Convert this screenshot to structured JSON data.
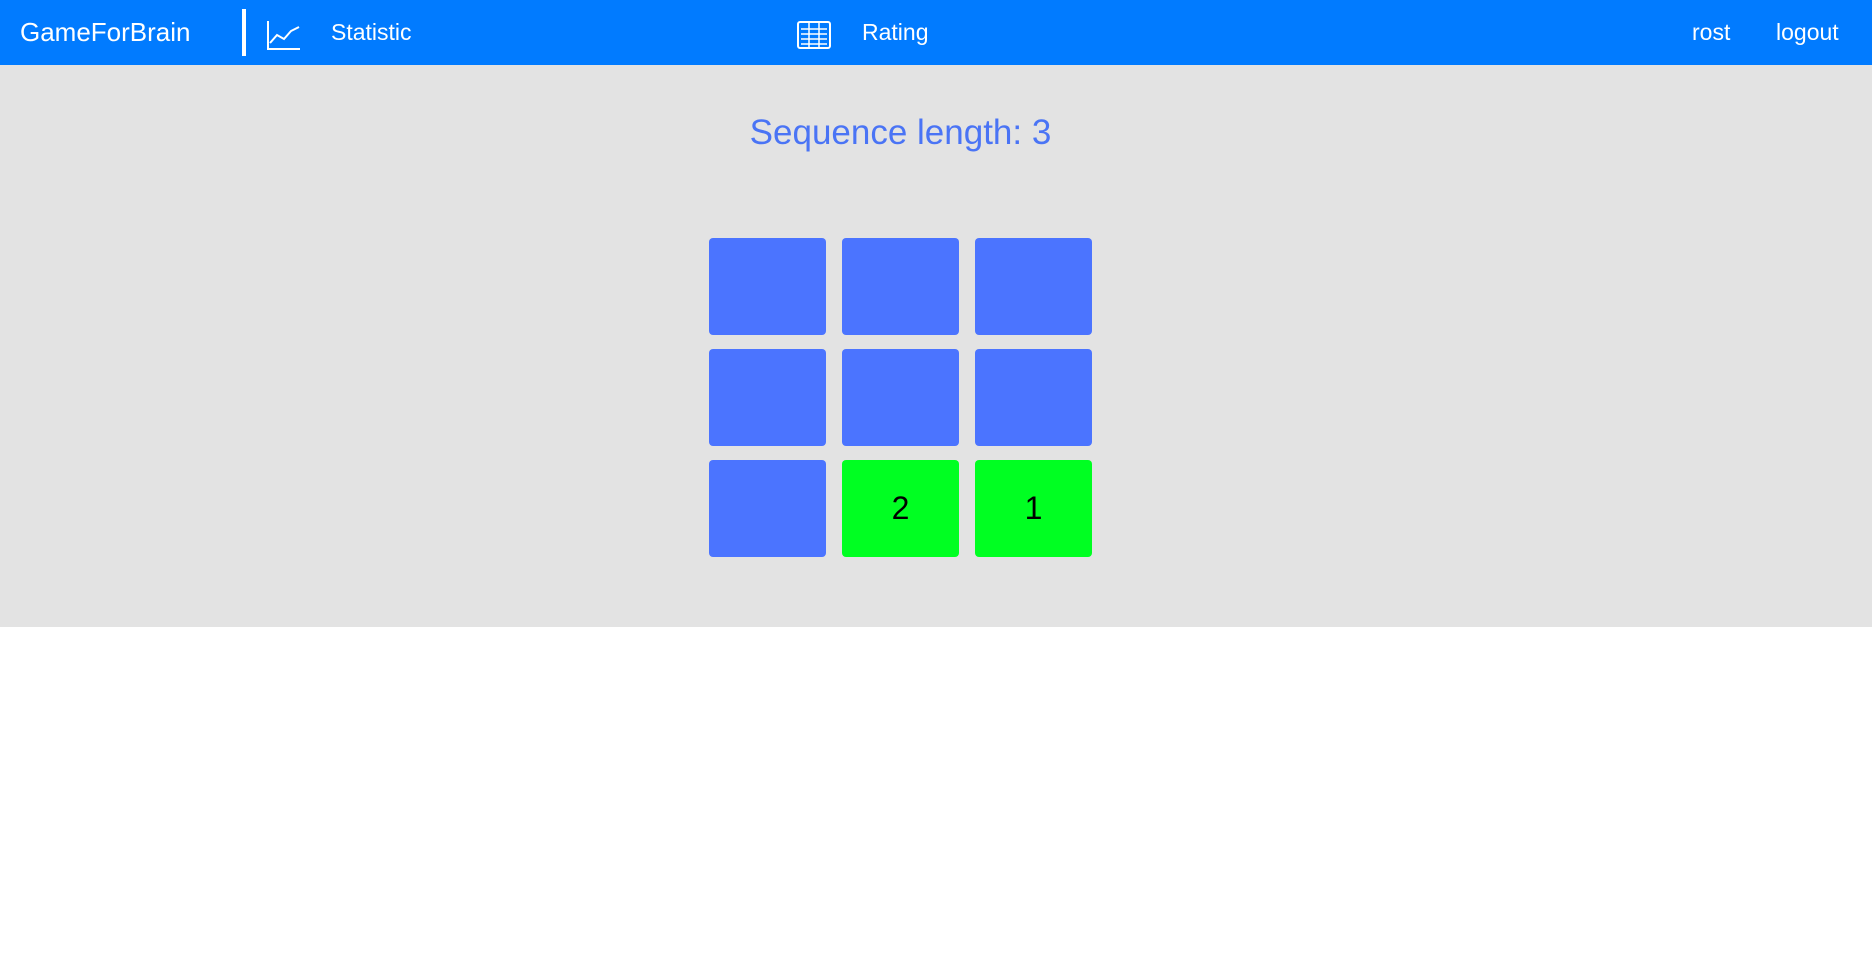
{
  "navbar": {
    "brand": "GameForBrain",
    "statistic_label": "Statistic",
    "statistic_icon": "line-chart-icon",
    "rating_label": "Rating",
    "rating_icon": "table-icon",
    "username": "rost",
    "logout_label": "logout",
    "bg_color": "#017bff"
  },
  "game": {
    "sequence_label": "Sequence length: 3",
    "tiles": [
      {
        "label": "",
        "state": "default"
      },
      {
        "label": "",
        "state": "default"
      },
      {
        "label": "",
        "state": "default"
      },
      {
        "label": "",
        "state": "default"
      },
      {
        "label": "",
        "state": "default"
      },
      {
        "label": "",
        "state": "default"
      },
      {
        "label": "",
        "state": "default"
      },
      {
        "label": "2",
        "state": "active"
      },
      {
        "label": "1",
        "state": "active"
      }
    ],
    "colors": {
      "tile_default": "#4b74ff",
      "tile_active": "#00ff22",
      "area_bg": "#e3e3e3",
      "title_text": "#4a74f5"
    }
  }
}
